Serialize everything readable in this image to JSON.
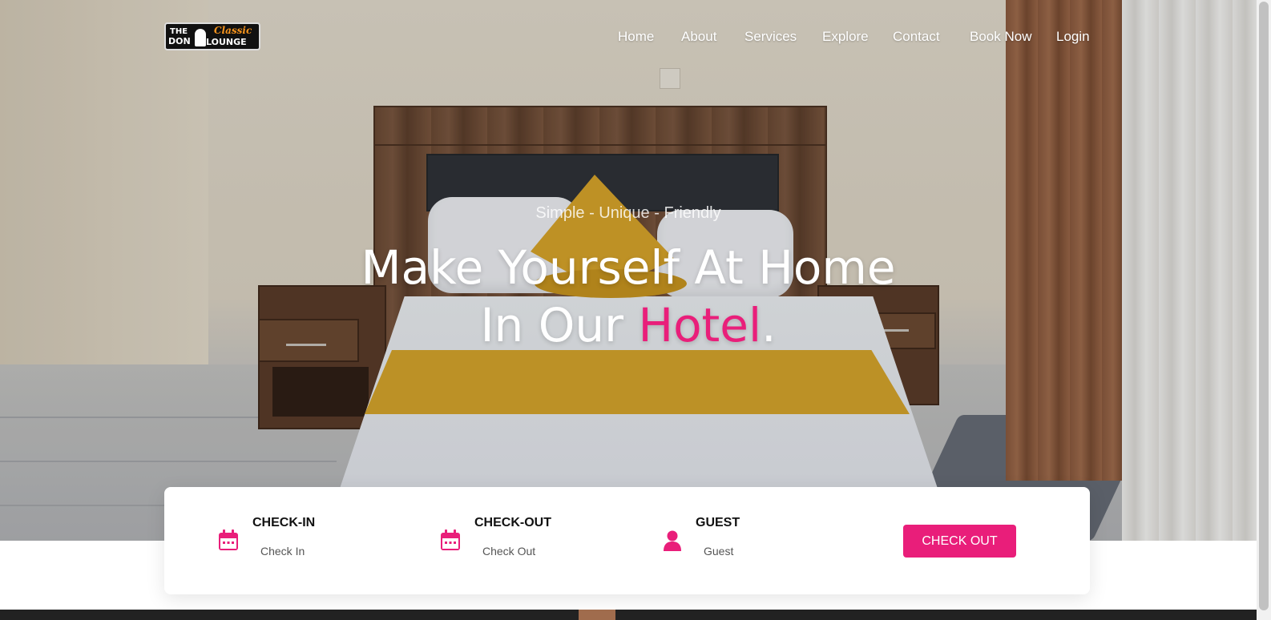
{
  "brand": {
    "logo_line1_left": "THE",
    "logo_line2_left": "DON",
    "logo_line1_right": "Classic",
    "logo_line2_right": "LOUNGE"
  },
  "nav": {
    "items": [
      {
        "label": "Home"
      },
      {
        "label": "About"
      },
      {
        "label": "Services"
      },
      {
        "label": "Explore"
      },
      {
        "label": "Contact"
      },
      {
        "label": "Book Now"
      },
      {
        "label": "Login"
      }
    ]
  },
  "hero": {
    "tagline": "Simple - Unique - Friendly",
    "headline_line1": "Make Yourself At Home",
    "headline_line2_prefix": "In Our ",
    "headline_line2_accent": "Hotel",
    "headline_line2_suffix": "."
  },
  "booking": {
    "checkin": {
      "label": "CHECK-IN",
      "placeholder": "Check In",
      "icon": "calendar-icon"
    },
    "checkout": {
      "label": "CHECK-OUT",
      "placeholder": "Check Out",
      "icon": "calendar-icon"
    },
    "guest": {
      "label": "GUEST",
      "placeholder": "Guest",
      "icon": "user-icon"
    },
    "submit_label": "CHECK OUT"
  },
  "colors": {
    "accent": "#e91e7a",
    "logo_orange": "#f7941d"
  }
}
